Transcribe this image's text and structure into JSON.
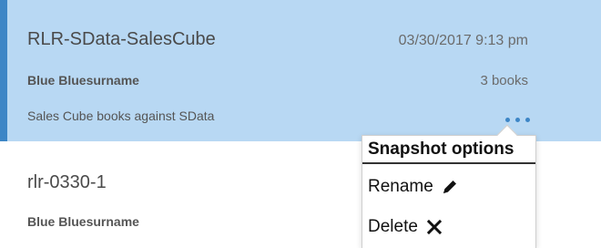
{
  "snapshots": [
    {
      "name": "RLR-SData-SalesCube",
      "date": "03/30/2017 9:13 pm",
      "owner": "Blue Bluesurname",
      "count": "3 books",
      "description": "Sales Cube books against SData",
      "selected": true
    },
    {
      "name": "rlr-0330-1",
      "owner": "Blue Bluesurname",
      "selected": false
    }
  ],
  "menu": {
    "title": "Snapshot options",
    "items": [
      {
        "label": "Rename",
        "icon": "pencil-icon"
      },
      {
        "label": "Delete",
        "icon": "close-icon"
      }
    ]
  },
  "colors": {
    "selected_background": "#b8d8f3",
    "selected_accent": "#3d86c6"
  }
}
